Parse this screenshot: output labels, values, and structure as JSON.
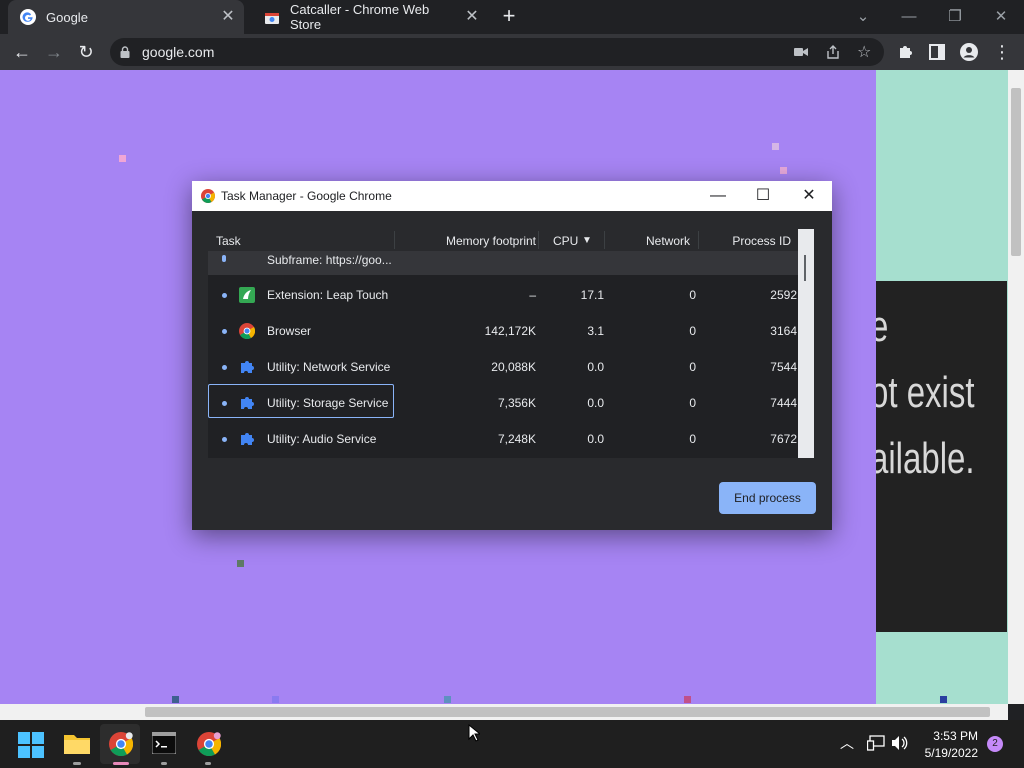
{
  "browser": {
    "tabs": [
      {
        "title": "Google",
        "favicon": "google-favicon-icon",
        "active": true
      },
      {
        "title": "Catcaller - Chrome Web Store",
        "favicon": "web-store-favicon-icon",
        "active": false
      }
    ],
    "new_tab": "+",
    "address": "google.com"
  },
  "page": {
    "background": "#a684f3",
    "side_text": [
      "e",
      "ot exist",
      "ailable."
    ]
  },
  "task_manager": {
    "window_title": "Task Manager - Google Chrome",
    "columns": {
      "task": "Task",
      "memory": "Memory footprint",
      "cpu": "CPU",
      "network": "Network",
      "pid": "Process ID"
    },
    "sort_indicator": "▼",
    "rows": [
      {
        "name": "Subframe: https://goo...",
        "memory": "",
        "cpu": "",
        "network": "",
        "pid": ""
      },
      {
        "name": "Extension: Leap Touch",
        "memory": "–",
        "cpu": "17.1",
        "network": "0",
        "pid": "2592"
      },
      {
        "name": "Browser",
        "memory": "142,172K",
        "cpu": "3.1",
        "network": "0",
        "pid": "3164"
      },
      {
        "name": "Utility: Network Service",
        "memory": "20,088K",
        "cpu": "0.0",
        "network": "0",
        "pid": "7544"
      },
      {
        "name": "Utility: Storage Service",
        "memory": "7,356K",
        "cpu": "0.0",
        "network": "0",
        "pid": "7444"
      },
      {
        "name": "Utility: Audio Service",
        "memory": "7,248K",
        "cpu": "0.0",
        "network": "0",
        "pid": "7672"
      }
    ],
    "selected_row": "Utility: Storage Service",
    "end_process_label": "End process"
  },
  "taskbar": {
    "time": "3:53 PM",
    "date": "5/19/2022",
    "notification_count": "2"
  },
  "colors": {
    "accent": "#8ab4f8",
    "page_background": "#a684f3",
    "side_panel": "#a6dfcf"
  }
}
